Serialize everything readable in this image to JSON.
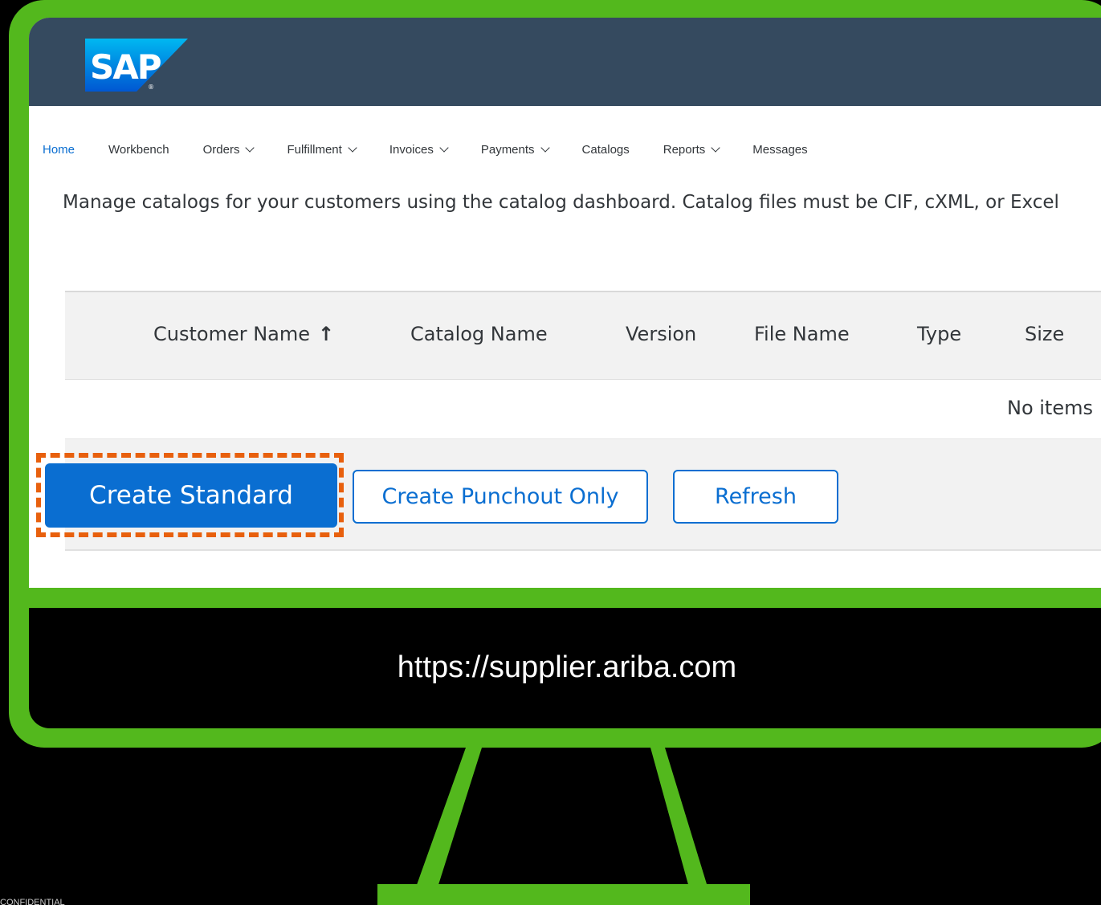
{
  "brand": {
    "logo_text": "SAP",
    "shell_color": "#354a5f",
    "accent_color": "#0a6ed1",
    "frame_color": "#53b81d",
    "highlight_color": "#e8600d"
  },
  "nav": {
    "items": [
      {
        "label": "Home",
        "active": true,
        "dropdown": false
      },
      {
        "label": "Workbench",
        "active": false,
        "dropdown": false
      },
      {
        "label": "Orders",
        "active": false,
        "dropdown": true
      },
      {
        "label": "Fulfillment",
        "active": false,
        "dropdown": true
      },
      {
        "label": "Invoices",
        "active": false,
        "dropdown": true
      },
      {
        "label": "Payments",
        "active": false,
        "dropdown": true
      },
      {
        "label": "Catalogs",
        "active": false,
        "dropdown": false
      },
      {
        "label": "Reports",
        "active": false,
        "dropdown": true
      },
      {
        "label": "Messages",
        "active": false,
        "dropdown": false
      }
    ]
  },
  "page": {
    "intro": "Manage catalogs for your customers using the catalog dashboard. Catalog files must be CIF, cXML, or Excel"
  },
  "table": {
    "columns": [
      {
        "label": "Customer Name",
        "sort_icon": "sort-ascending-icon",
        "sort_glyph": "↑"
      },
      {
        "label": "Catalog Name"
      },
      {
        "label": "Version"
      },
      {
        "label": "File Name"
      },
      {
        "label": "Type"
      },
      {
        "label": "Size"
      }
    ],
    "empty_text": "No items"
  },
  "actions": {
    "create_standard": "Create Standard",
    "create_punchout": "Create Punchout Only",
    "refresh": "Refresh"
  },
  "caption": {
    "url": "https://supplier.ariba.com"
  },
  "footer": {
    "confidential": "CONFIDENTIAL"
  }
}
